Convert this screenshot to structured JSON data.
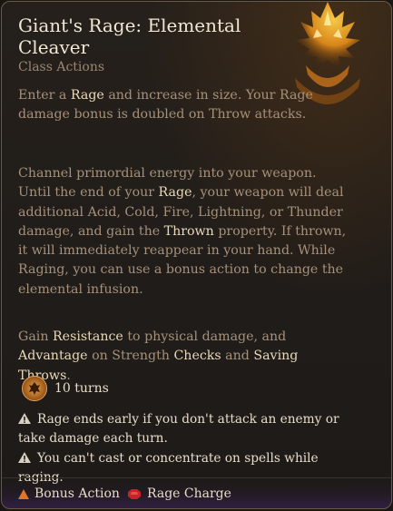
{
  "spell": {
    "title": "Giant's Rage: Elemental Cleaver",
    "subtitle": "Class Actions",
    "p1": {
      "t0": "Enter a ",
      "kw0": "Rage",
      "t1": " and increase in size. Your Rage damage bonus is doubled on Throw attacks."
    },
    "p2": {
      "t0": "Channel primordial energy into your weapon. Until the end of your ",
      "kw0": "Rage",
      "t1": ", your weapon will deal additional Acid, Cold, Fire, Lightning, or Thunder damage, and gain the ",
      "kw1": "Thrown",
      "t2": " property. If thrown, it will immediately reappear in your hand. While Raging, you can use a bonus action to change the elemental infusion."
    },
    "p3": {
      "t0": "Gain ",
      "kw0": "Resistance",
      "t1": " to physical damage, and ",
      "kw1": "Advantage",
      "t2": " on Strength ",
      "kw2": "Checks",
      "t3": " and ",
      "kw3": "Saving Throws",
      "t4": "."
    },
    "duration": "10 turns",
    "warnings": [
      "Rage ends early if you don't attack an enemy or take damage each turn.",
      "You can't cast or concentrate on spells while raging."
    ],
    "costs": [
      {
        "label": "Bonus Action",
        "icon": "triangle-icon",
        "color": "#e2742a"
      },
      {
        "label": "Rage Charge",
        "icon": "rage-charge-icon",
        "color": "#c2262b"
      }
    ]
  }
}
